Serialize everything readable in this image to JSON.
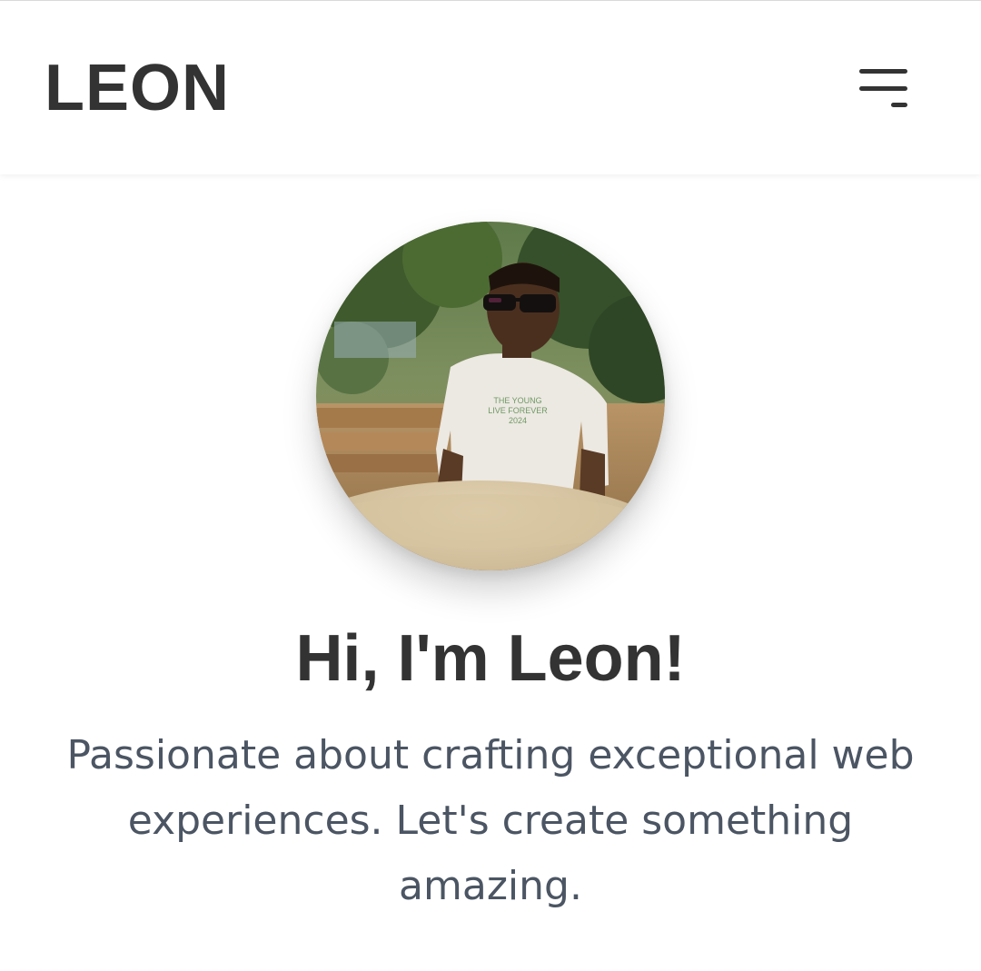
{
  "header": {
    "logo": "LEON",
    "menu_icon": "hamburger-menu-icon"
  },
  "hero": {
    "avatar_icon": "profile-photo",
    "title": "Hi, I'm Leon!",
    "description": "Passionate about crafting exceptional web experiences. Let's create something amazing.",
    "shirt_text": [
      "THE YOUNG",
      "LIVE FOREVER",
      "2024"
    ]
  },
  "colors": {
    "text_primary": "#333333",
    "text_secondary": "#4b5563",
    "background": "#ffffff"
  }
}
